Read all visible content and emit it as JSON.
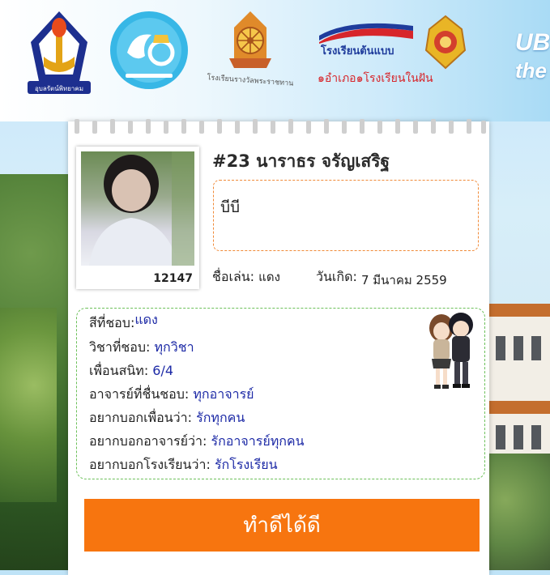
{
  "header": {
    "logos": [
      {
        "icon": "school-torch-emblem-icon",
        "caption": "อุบลรัตน์พิทยาคม"
      },
      {
        "icon": "anniversary-60-emblem-icon"
      },
      {
        "icon": "dharma-wheel-emblem-icon",
        "caption": "โรงเรียนรางวัลพระราชทาน"
      },
      {
        "icon": "model-school-emblem-icon",
        "title": "โรงเรียนต้นแบบ",
        "subtitle": "๑อำเภอ๑โรงเรียนในฝัน"
      },
      {
        "icon": "royal-emblem-icon"
      }
    ],
    "tagline_line1": "UB",
    "tagline_line2": "the"
  },
  "profile": {
    "name": "#23 นาราธร จรัญเสริฐ",
    "student_id": "12147",
    "message": "บีบี",
    "nickname_label": "ชื่อเล่น:",
    "nickname_value": "แดง",
    "birthday_label": "วันเกิด:",
    "birthday_value": "7 มีนาคม 2559"
  },
  "favorites": [
    {
      "label": "สีที่ชอบ:",
      "value": "แดง"
    },
    {
      "label": "วิชาที่ชอบ:",
      "value": "ทุกวิชา"
    },
    {
      "label": "เพื่อนสนิท:",
      "value": "6/4"
    },
    {
      "label": "อาจารย์ที่ชื่นชอบ:",
      "value": "ทุกอาจารย์"
    },
    {
      "label": "อยากบอกเพื่อนว่า:",
      "value": "รักทุกคน"
    },
    {
      "label": "อยากบอกอาจารย์ว่า:",
      "value": "รักอาจารย์ทุกคน"
    },
    {
      "label": "อยากบอกโรงเรียนว่า:",
      "value": "รักโรงเรียน"
    }
  ],
  "action_button": {
    "label": "ทำดีได้ดี"
  },
  "colors": {
    "accent_orange": "#f7750f",
    "dashed_orange": "#f08a38",
    "dashed_green": "#6cc05a",
    "value_blue": "#1d2aa6"
  }
}
